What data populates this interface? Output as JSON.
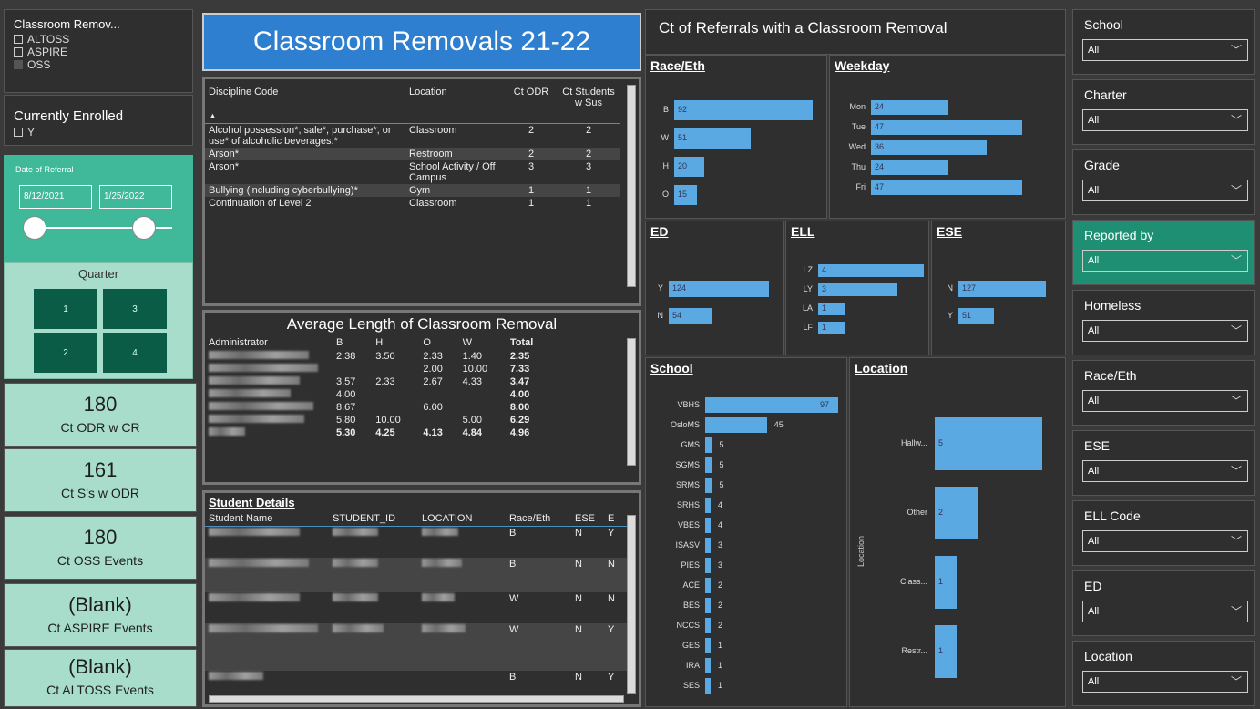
{
  "left": {
    "removal_filter": {
      "title": "Classroom Remov...",
      "options": [
        {
          "label": "ALTOSS",
          "checked": false
        },
        {
          "label": "ASPIRE",
          "checked": false
        },
        {
          "label": "OSS",
          "checked": true
        }
      ]
    },
    "enrolled_filter": {
      "title": "Currently Enrolled",
      "option": "Y"
    },
    "date_filter": {
      "title": "Date of Referral",
      "start": "8/12/2021",
      "end": "1/25/2022"
    },
    "quarter": {
      "title": "Quarter",
      "buttons": [
        "1",
        "3",
        "2",
        "4"
      ]
    },
    "kpis": [
      {
        "value": "180",
        "label": "Ct ODR w CR"
      },
      {
        "value": "161",
        "label": "Ct S's w ODR"
      },
      {
        "value": "180",
        "label": "Ct OSS Events"
      },
      {
        "value": "(Blank)",
        "label": "Ct ASPIRE Events"
      },
      {
        "value": "(Blank)",
        "label": "Ct ALTOSS Events"
      }
    ]
  },
  "main_title": "Classroom Removals 21-22",
  "discipline_table": {
    "headers": [
      "Discipline Code",
      "Location",
      "Ct ODR",
      "Ct Students w Sus"
    ],
    "rows": [
      [
        "Alcohol possession*, sale*, purchase*, or use* of alcoholic beverages.*",
        "Classroom",
        "2",
        "2"
      ],
      [
        "Arson*",
        "Restroom",
        "2",
        "2"
      ],
      [
        "Arson*",
        "School Activity / Off Campus",
        "3",
        "3"
      ],
      [
        "Bullying (including cyberbullying)*",
        "Gym",
        "1",
        "1"
      ],
      [
        "Continuation of Level 2",
        "Classroom",
        "1",
        "1"
      ]
    ]
  },
  "avg_table": {
    "title": "Average Length of Classroom Removal",
    "headers": [
      "Administrator",
      "B",
      "H",
      "O",
      "W",
      "Total"
    ],
    "rows": [
      [
        "",
        "2.38",
        "3.50",
        "2.33",
        "1.40",
        "2.35"
      ],
      [
        "",
        "",
        "",
        "2.00",
        "10.00",
        "7.33"
      ],
      [
        "",
        "3.57",
        "2.33",
        "2.67",
        "4.33",
        "3.47"
      ],
      [
        "",
        "4.00",
        "",
        "",
        "",
        "4.00"
      ],
      [
        "",
        "8.67",
        "",
        "6.00",
        "",
        "8.00"
      ],
      [
        "",
        "5.80",
        "10.00",
        "",
        "5.00",
        "6.29"
      ],
      [
        "",
        "5.30",
        "4.25",
        "4.13",
        "4.84",
        "4.96"
      ]
    ]
  },
  "student_table": {
    "title": "Student Details",
    "headers": [
      "Student Name",
      "STUDENT_ID",
      "LOCATION",
      "Race/Eth",
      "ESE",
      "E"
    ],
    "rows": [
      [
        "B",
        "N",
        "Y"
      ],
      [
        "B",
        "N",
        "N"
      ],
      [
        "W",
        "N",
        "N"
      ],
      [
        "W",
        "N",
        "Y"
      ],
      [
        "B",
        "N",
        "Y"
      ]
    ]
  },
  "charts_title": "Ct of Referrals with a Classroom Removal",
  "chart_data": [
    {
      "type": "bar",
      "title": "Race/Eth",
      "categories": [
        "B",
        "W",
        "H",
        "O"
      ],
      "values": [
        92,
        51,
        20,
        15
      ]
    },
    {
      "type": "bar",
      "title": "Weekday",
      "categories": [
        "Mon",
        "Tue",
        "Wed",
        "Thu",
        "Fri"
      ],
      "values": [
        24,
        47,
        36,
        24,
        47
      ]
    },
    {
      "type": "bar",
      "title": "ED",
      "categories": [
        "Y",
        "N"
      ],
      "values": [
        124,
        54
      ]
    },
    {
      "type": "bar",
      "title": "ELL",
      "categories": [
        "LZ",
        "LY",
        "LA",
        "LF"
      ],
      "values": [
        4,
        3,
        1,
        1
      ]
    },
    {
      "type": "bar",
      "title": "ESE",
      "categories": [
        "N",
        "Y"
      ],
      "values": [
        127,
        51
      ]
    },
    {
      "type": "bar",
      "title": "School",
      "categories": [
        "VBHS",
        "OsloMS",
        "GMS",
        "SGMS",
        "SRMS",
        "SRHS",
        "VBES",
        "ISASV",
        "PIES",
        "ACE",
        "BES",
        "NCCS",
        "GES",
        "IRA",
        "SES"
      ],
      "values": [
        97,
        45,
        5,
        5,
        5,
        4,
        4,
        3,
        3,
        2,
        2,
        2,
        1,
        1,
        1
      ]
    },
    {
      "type": "bar",
      "title": "Location",
      "ylabel": "Location",
      "categories": [
        "Hallw...",
        "Other",
        "Class...",
        "Restr..."
      ],
      "values": [
        5,
        2,
        1,
        1
      ]
    }
  ],
  "slicers": [
    {
      "title": "School",
      "value": "All"
    },
    {
      "title": "Charter",
      "value": "All"
    },
    {
      "title": "Grade",
      "value": "All"
    },
    {
      "title": "Reported by",
      "value": "All"
    },
    {
      "title": "Homeless",
      "value": "All"
    },
    {
      "title": "Race/Eth",
      "value": "All"
    },
    {
      "title": "ESE",
      "value": "All"
    },
    {
      "title": "ELL Code",
      "value": "All"
    },
    {
      "title": "ED",
      "value": "All"
    },
    {
      "title": "Location",
      "value": "All"
    }
  ],
  "colors": {
    "accent": "#1f8f74",
    "bar": "#5ba9e2",
    "kpi_bg": "#a8dccb",
    "title_bg": "#2f7fd0",
    "quarter_btn": "#0b5c47"
  }
}
